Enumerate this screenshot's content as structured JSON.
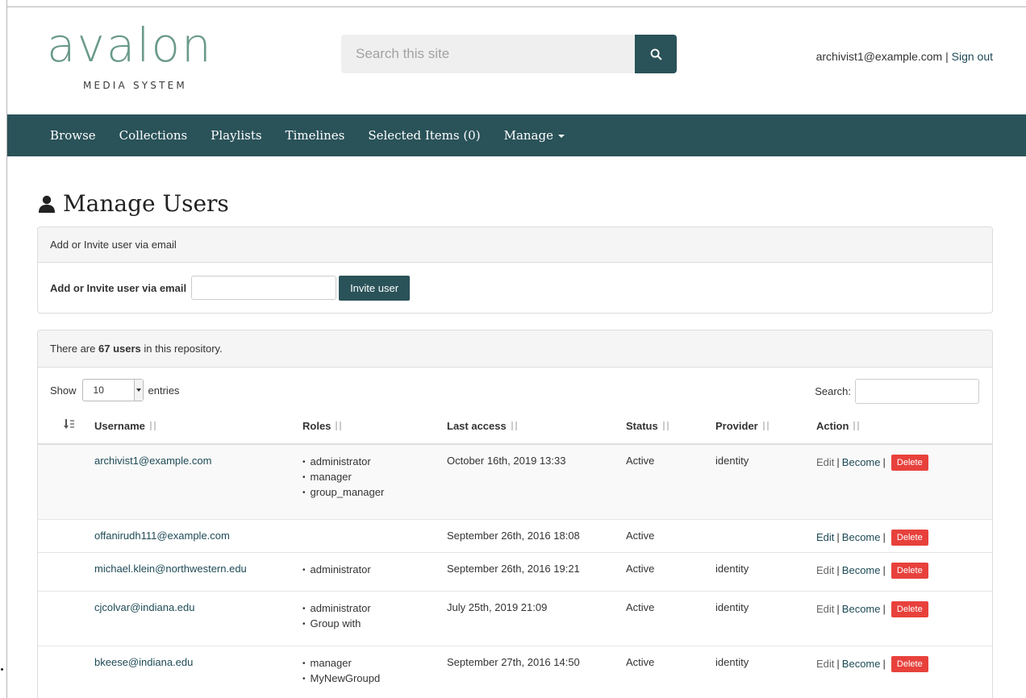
{
  "header": {
    "logo_word": "avalon",
    "logo_sub": "MEDIA SYSTEM",
    "search_placeholder": "Search this site",
    "user_email": "archivist1@example.com",
    "user_sep": " | ",
    "sign_out": "Sign out"
  },
  "nav": {
    "items": [
      "Browse",
      "Collections",
      "Playlists",
      "Timelines",
      "Selected Items (0)",
      "Manage"
    ]
  },
  "page": {
    "title": "Manage Users"
  },
  "invite_panel": {
    "heading": "Add or Invite user via email",
    "label": "Add or Invite user via email",
    "email_value": "",
    "button": "Invite user"
  },
  "users_panel": {
    "count_prefix": "There are ",
    "count_value": "67 users",
    "count_suffix": " in this repository.",
    "show_label": "Show",
    "show_value": "10",
    "entries_label": "entries",
    "search_label": "Search:",
    "search_value": ""
  },
  "table": {
    "columns": [
      "Username",
      "Roles",
      "Last access",
      "Status",
      "Provider",
      "Action"
    ],
    "actions": {
      "edit": "Edit",
      "become": "Become",
      "delete": "Delete",
      "sep": "|"
    },
    "rows": [
      {
        "username": "archivist1@example.com",
        "roles": [
          "administrator",
          "manager",
          "group_manager"
        ],
        "last_access": "October 16th, 2019 13:33",
        "status": "Active",
        "provider": "identity"
      },
      {
        "username": "offanirudh111@example.com",
        "roles": [],
        "last_access": "September 26th, 2016 18:08",
        "status": "Active",
        "provider": ""
      },
      {
        "username": "michael.klein@northwestern.edu",
        "roles": [
          "administrator"
        ],
        "last_access": "September 26th, 2016 19:21",
        "status": "Active",
        "provider": "identity"
      },
      {
        "username": "cjcolvar@indiana.edu",
        "roles": [
          "administrator",
          "Group with"
        ],
        "last_access": "July 25th, 2019 21:09",
        "status": "Active",
        "provider": "identity"
      },
      {
        "username": "bkeese@indiana.edu",
        "roles": [
          "manager",
          "MyNewGroupd"
        ],
        "last_access": "September 27th, 2016 14:50",
        "status": "Active",
        "provider": "identity"
      }
    ]
  },
  "colors": {
    "brand": "#2a5259",
    "logo": "#6a9a88",
    "danger": "#e8413c",
    "link": "#1e4a56"
  }
}
